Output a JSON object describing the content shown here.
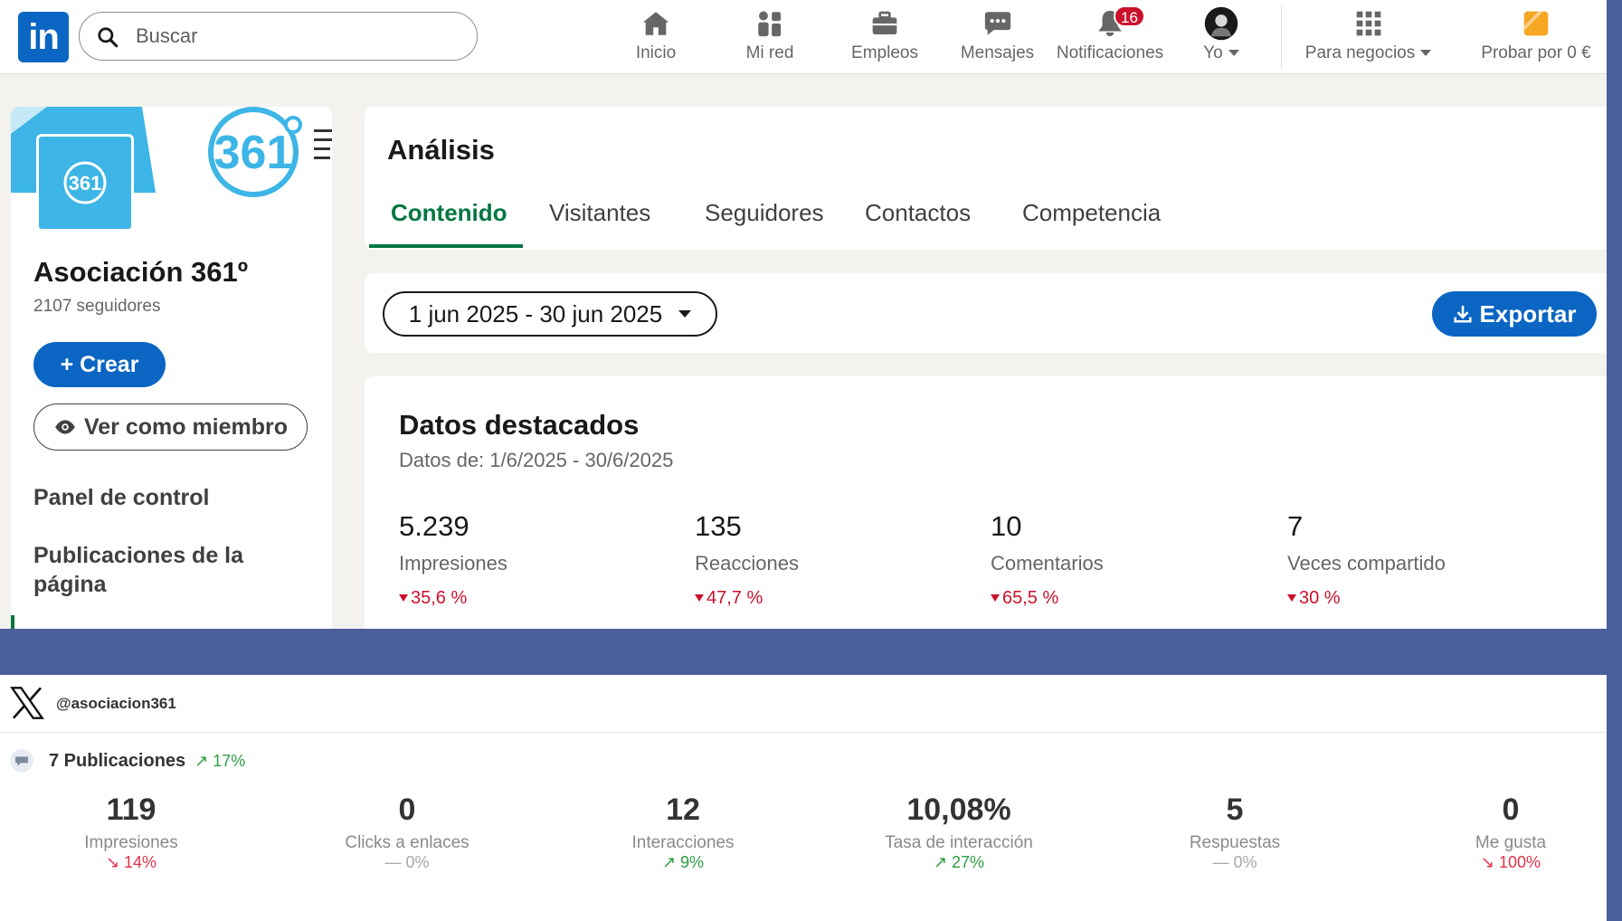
{
  "linkedin": {
    "nav": {
      "logo": "in",
      "search_placeholder": "Buscar",
      "items": [
        {
          "label": "Inicio",
          "icon": "home-icon"
        },
        {
          "label": "Mi red",
          "icon": "network-icon"
        },
        {
          "label": "Empleos",
          "icon": "briefcase-icon"
        },
        {
          "label": "Mensajes",
          "icon": "messages-icon"
        },
        {
          "label": "Notificaciones",
          "icon": "bell-icon",
          "badge": "16"
        },
        {
          "label": "Yo",
          "icon": "profile-avatar"
        },
        {
          "label": "Para negocios",
          "icon": "grid-icon"
        },
        {
          "label": "Probar por 0 €",
          "icon": "premium-icon"
        }
      ]
    },
    "sidebar": {
      "org_name": "Asociación 361º",
      "followers": "2107 seguidores",
      "logo_text": "361",
      "create_label": "Crear",
      "view_member_label": "Ver como miembro",
      "links": [
        "Panel de control",
        "Publicaciones de la página"
      ]
    },
    "analytics": {
      "title": "Análisis",
      "tabs": [
        "Contenido",
        "Visitantes",
        "Seguidores",
        "Contactos",
        "Competencia"
      ],
      "active_tab": "Contenido",
      "date_range": "1 jun 2025 - 30 jun 2025",
      "export_label": "Exportar"
    },
    "highlights": {
      "title": "Datos destacados",
      "subtitle": "Datos de: 1/6/2025 - 30/6/2025",
      "metrics": [
        {
          "value": "5.239",
          "label": "Impresiones",
          "delta": "35,6 %",
          "trend": "down"
        },
        {
          "value": "135",
          "label": "Reacciones",
          "delta": "47,7 %",
          "trend": "down"
        },
        {
          "value": "10",
          "label": "Comentarios",
          "delta": "65,5 %",
          "trend": "down"
        },
        {
          "value": "7",
          "label": "Veces compartido",
          "delta": "30 %",
          "trend": "down"
        }
      ]
    }
  },
  "x": {
    "handle": "@asociacion361",
    "posts_label": "7 Publicaciones",
    "posts_delta": "17%",
    "metrics": [
      {
        "value": "119",
        "label": "Impresiones",
        "delta": "14%",
        "trend": "down"
      },
      {
        "value": "0",
        "label": "Clicks a enlaces",
        "delta": "0%",
        "trend": "flat"
      },
      {
        "value": "12",
        "label": "Interacciones",
        "delta": "9%",
        "trend": "up"
      },
      {
        "value": "10,08%",
        "label": "Tasa de interacción",
        "delta": "27%",
        "trend": "up"
      },
      {
        "value": "5",
        "label": "Respuestas",
        "delta": "0%",
        "trend": "flat"
      },
      {
        "value": "0",
        "label": "Me gusta",
        "delta": "100%",
        "trend": "down"
      }
    ]
  },
  "colors": {
    "background": "#4a5f9c",
    "linkedin_blue": "#0a66c2",
    "linkedin_green": "#057642",
    "negative_red": "#cb112d",
    "x_up": "#2e9e44",
    "x_down": "#e0334b",
    "brand_cyan": "#3db5e6"
  }
}
